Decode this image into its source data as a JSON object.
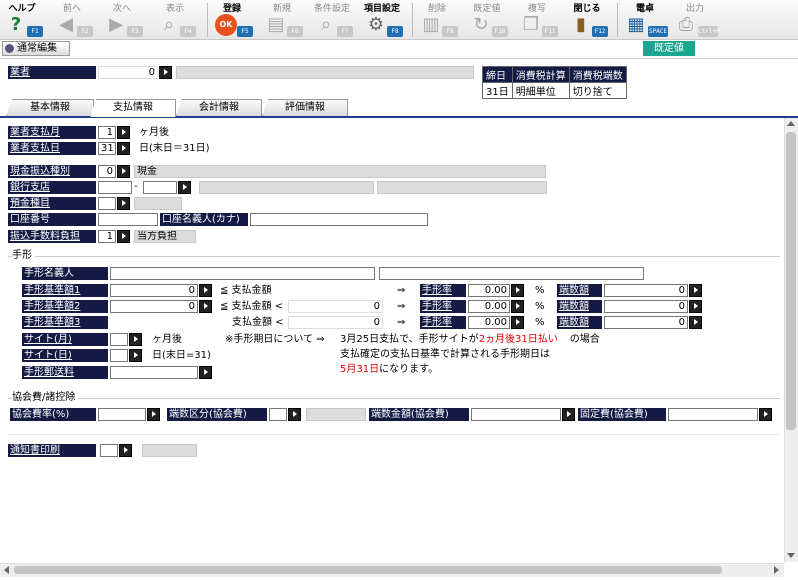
{
  "toolbar": {
    "help": "ヘルプ",
    "help_key": "F1",
    "prev": "前へ",
    "prev_key": "F2",
    "next": "次へ",
    "next_key": "F3",
    "show": "表示",
    "show_key": "F4",
    "register": "登録",
    "register_key": "F5",
    "new": "新規",
    "new_key": "F6",
    "cond": "条件設定",
    "cond_key": "F7",
    "items": "項目設定",
    "items_key": "F8",
    "delete": "削除",
    "delete_key": "F9",
    "default": "既定値",
    "default_key": "F10",
    "copy": "複写",
    "copy_key": "F11",
    "close": "閉じる",
    "close_key": "F12",
    "calc": "電卓",
    "calc_key": "SPACE",
    "output": "出力",
    "output_key": "Ctrl+P"
  },
  "mode_label": "通常編集",
  "default_badge": "既定値",
  "vendor": {
    "label": "業者",
    "value": "0"
  },
  "summary": {
    "headers": [
      "締日",
      "消費税計算",
      "消費税端数"
    ],
    "row": [
      "31日",
      "明細単位",
      "切り捨て"
    ]
  },
  "tabs": [
    "基本情報",
    "支払情報",
    "会計情報",
    "評価情報"
  ],
  "pay": {
    "month_label": "業者支払月",
    "month_value": "1",
    "month_suffix": "ヶ月後",
    "day_label": "業者支払日",
    "day_value": "31",
    "day_suffix": "日(末日＝31日)",
    "cash_label": "現金振込種別",
    "cash_value": "0",
    "cash_text": "現金",
    "bank_label": "銀行支店",
    "bank_dash": "-",
    "deposit_label": "預金種目",
    "account_label": "口座番号",
    "account_name_label": "口座名義人(カナ)",
    "fee_label": "振込手数料負担",
    "fee_value": "1",
    "fee_text": "当方負担"
  },
  "bill": {
    "section": "手形",
    "name_label": "手形名義人",
    "std1_label": "手形基準額1",
    "std1_value": "0",
    "std1_op": "≦ 支払金額",
    "std2_label": "手形基準額2",
    "std2_value": "0",
    "std2_op": "≦ 支払金額 <",
    "std2_mid": "0",
    "std3_label": "手形基準額3",
    "std3_op": "支払金額 <",
    "std3_mid": "0",
    "arrow": "⇒",
    "rate_label": "手形率",
    "rate_value": "0.00",
    "pct": "%",
    "frac_label": "端数額",
    "frac_value": "0",
    "site_month_label": "サイト(月)",
    "site_month_suffix": "ヶ月後",
    "site_day_label": "サイト(日)",
    "site_day_suffix": "日(末日=31)",
    "postage_label": "手形郵送料",
    "note_title": "※手形期日について ⇒",
    "note_line1a": "3月25日支払で、手形サイトが",
    "note_line1b": "2ヵ月後31日払い",
    "note_line1c": "の場合",
    "note_line2": "支払確定の支払日基準で計算される手形期日は",
    "note_line3a": "5月31日",
    "note_line3b": "になります。"
  },
  "assoc": {
    "section": "協会費/諸控除",
    "rate_label": "協会費率(%)",
    "frac_type_label": "端数区分(協会費)",
    "frac_amt_label": "端数金額(協会費)",
    "fixed_label": "固定費(協会費)"
  },
  "notice": {
    "label": "通知書印刷"
  }
}
